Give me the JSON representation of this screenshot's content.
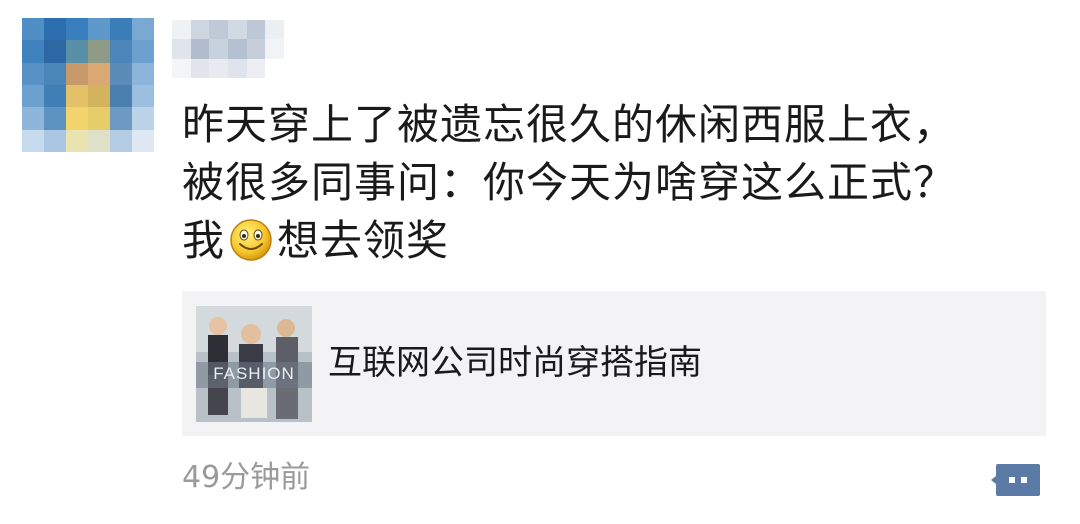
{
  "post": {
    "text_lines": [
      "昨天穿上了被遗忘很久的休闲西服上衣，",
      "被很多同事问：你今天为啥穿这么正式？"
    ],
    "last_line_before_emoji": "我",
    "last_line_after_emoji": "想去领奖",
    "emoji": "smiley-face-icon"
  },
  "shared_link": {
    "title": "互联网公司时尚穿搭指南",
    "thumbnail_text": "FASHION"
  },
  "meta": {
    "timestamp": "49分钟前"
  },
  "colors": {
    "text": "#1a1a1a",
    "meta_text": "#9a9a9a",
    "card_bg": "#f3f3f5",
    "comment_icon": "#5c7aa6"
  }
}
